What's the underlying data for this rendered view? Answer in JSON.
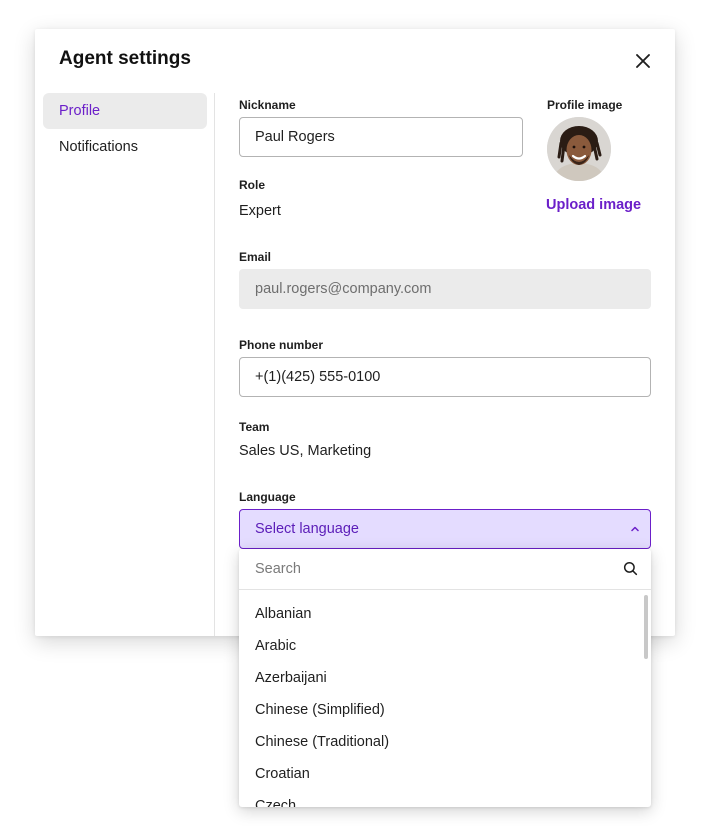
{
  "modal": {
    "title": "Agent settings"
  },
  "nav": {
    "items": [
      {
        "label": "Profile"
      },
      {
        "label": "Notifications"
      }
    ]
  },
  "profile": {
    "nickname_label": "Nickname",
    "nickname_value": "Paul Rogers",
    "image_label": "Profile image",
    "upload_label": "Upload image",
    "role_label": "Role",
    "role_value": "Expert",
    "email_label": "Email",
    "email_value": "paul.rogers@company.com",
    "phone_label": "Phone number",
    "phone_value": "+(1)(425) 555-0100",
    "team_label": "Team",
    "team_value": "Sales US, Marketing",
    "language_label": "Language",
    "language_placeholder": "Select language"
  },
  "dropdown": {
    "search_placeholder": "Search",
    "options": [
      "Albanian",
      "Arabic",
      "Azerbaijani",
      "Chinese (Simplified)",
      "Chinese (Traditional)",
      "Croatian",
      "Czech"
    ]
  },
  "colors": {
    "accent": "#6b1fc9",
    "select_bg": "#e4dcff",
    "nav_active_bg": "#ebebeb",
    "disabled_bg": "#ebebeb"
  },
  "icons": {
    "close": "close-icon",
    "chevron": "chevron-up-icon",
    "search": "search-icon"
  }
}
